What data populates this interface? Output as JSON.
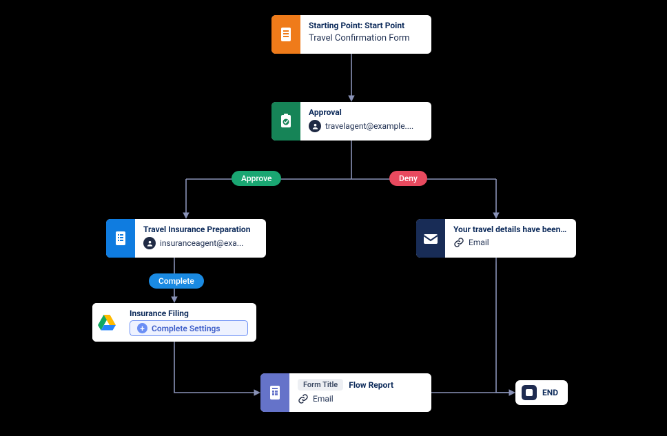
{
  "nodes": {
    "start": {
      "title": "Starting Point: Start Point",
      "subtitle": "Travel Confirmation Form",
      "icon": "document-icon",
      "color": "#ef7b1a"
    },
    "approval": {
      "title": "Approval",
      "assignee": "travelagent@example....",
      "icon": "approval-icon",
      "color": "#168457"
    },
    "insurance_prep": {
      "title": "Travel Insurance Preparation",
      "assignee": "insuranceagent@exa...",
      "icon": "checklist-icon",
      "color": "#0f7ce0"
    },
    "travel_details": {
      "title": "Your travel details have been ...",
      "channel": "Email",
      "icon": "envelope-icon",
      "color": "#182c56"
    },
    "insurance_filing": {
      "title": "Insurance Filing",
      "action": "Complete Settings",
      "icon": "google-drive-icon",
      "color": "#ffffff"
    },
    "form_report": {
      "form_title_chip": "Form Title",
      "flow_report_label": "Flow Report",
      "channel": "Email",
      "icon": "form-icon",
      "color": "#6573c9"
    },
    "end": {
      "label": "END"
    }
  },
  "edges": {
    "approve": "Approve",
    "deny": "Deny",
    "complete": "Complete"
  }
}
